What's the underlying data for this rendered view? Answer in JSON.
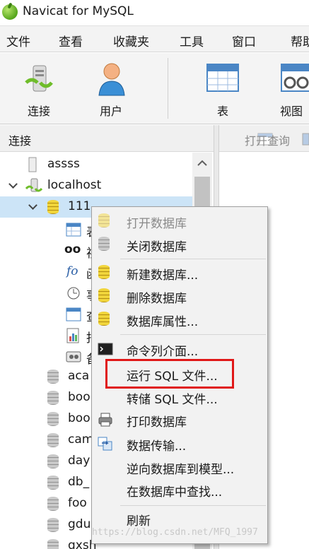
{
  "window": {
    "title": "Navicat for MySQL"
  },
  "menu": [
    "文件",
    "查看",
    "收藏夹",
    "工具",
    "窗口",
    "帮助"
  ],
  "toolbar": {
    "connect": "连接",
    "user": "用户",
    "table": "表",
    "view": "视图"
  },
  "left_pane": {
    "header": "连接",
    "tree": [
      {
        "label": "assss",
        "icon": "server-icon"
      },
      {
        "label": "localhost",
        "icon": "connection-icon",
        "expanded": true
      },
      {
        "label": "111",
        "icon": "database-open-icon",
        "expanded": true,
        "selected": true
      },
      {
        "label": "aca",
        "icon": "database-icon"
      },
      {
        "label": "boo",
        "icon": "database-icon"
      },
      {
        "label": "boo",
        "icon": "database-icon"
      },
      {
        "label": "cam",
        "icon": "database-icon"
      },
      {
        "label": "day",
        "icon": "database-icon"
      },
      {
        "label": "db_",
        "icon": "database-icon"
      },
      {
        "label": "foo",
        "icon": "database-icon"
      },
      {
        "label": "gdu",
        "icon": "database-icon"
      },
      {
        "label": "gxsh",
        "icon": "database-icon"
      }
    ],
    "child_glyphs": [
      "表",
      "视",
      "函",
      "事",
      "查",
      "报",
      "备"
    ]
  },
  "right_pane": {
    "open_query": "打开查询"
  },
  "context_menu": {
    "items": [
      {
        "label": "打开数据库",
        "disabled": true,
        "icon": "database-open-icon"
      },
      {
        "label": "关闭数据库",
        "disabled": false,
        "icon": "database-close-icon"
      },
      {
        "label": "新建数据库...",
        "disabled": false,
        "icon": "database-add-icon"
      },
      {
        "label": "删除数据库",
        "disabled": false,
        "icon": "database-delete-icon"
      },
      {
        "label": "数据库属性...",
        "disabled": false,
        "icon": "database-properties-icon"
      },
      {
        "label": "命令列介面...",
        "disabled": false,
        "icon": "console-icon"
      },
      {
        "label": "运行 SQL 文件...",
        "disabled": false,
        "icon": "",
        "highlighted": true
      },
      {
        "label": "转储 SQL 文件...",
        "disabled": false,
        "icon": ""
      },
      {
        "label": "打印数据库",
        "disabled": false,
        "icon": "printer-icon"
      },
      {
        "label": "数据传输...",
        "disabled": false,
        "icon": "data-transfer-icon"
      },
      {
        "label": "逆向数据库到模型...",
        "disabled": false,
        "icon": ""
      },
      {
        "label": "在数据库中查找...",
        "disabled": false,
        "icon": ""
      },
      {
        "label": "刷新",
        "disabled": false,
        "icon": ""
      }
    ]
  },
  "watermark": "https://blog.csdn.net/MFQ_1997",
  "colors": {
    "selection": "#cce4f7",
    "highlight_box": "#e01818",
    "menu_bg": "#f2f2f2"
  }
}
